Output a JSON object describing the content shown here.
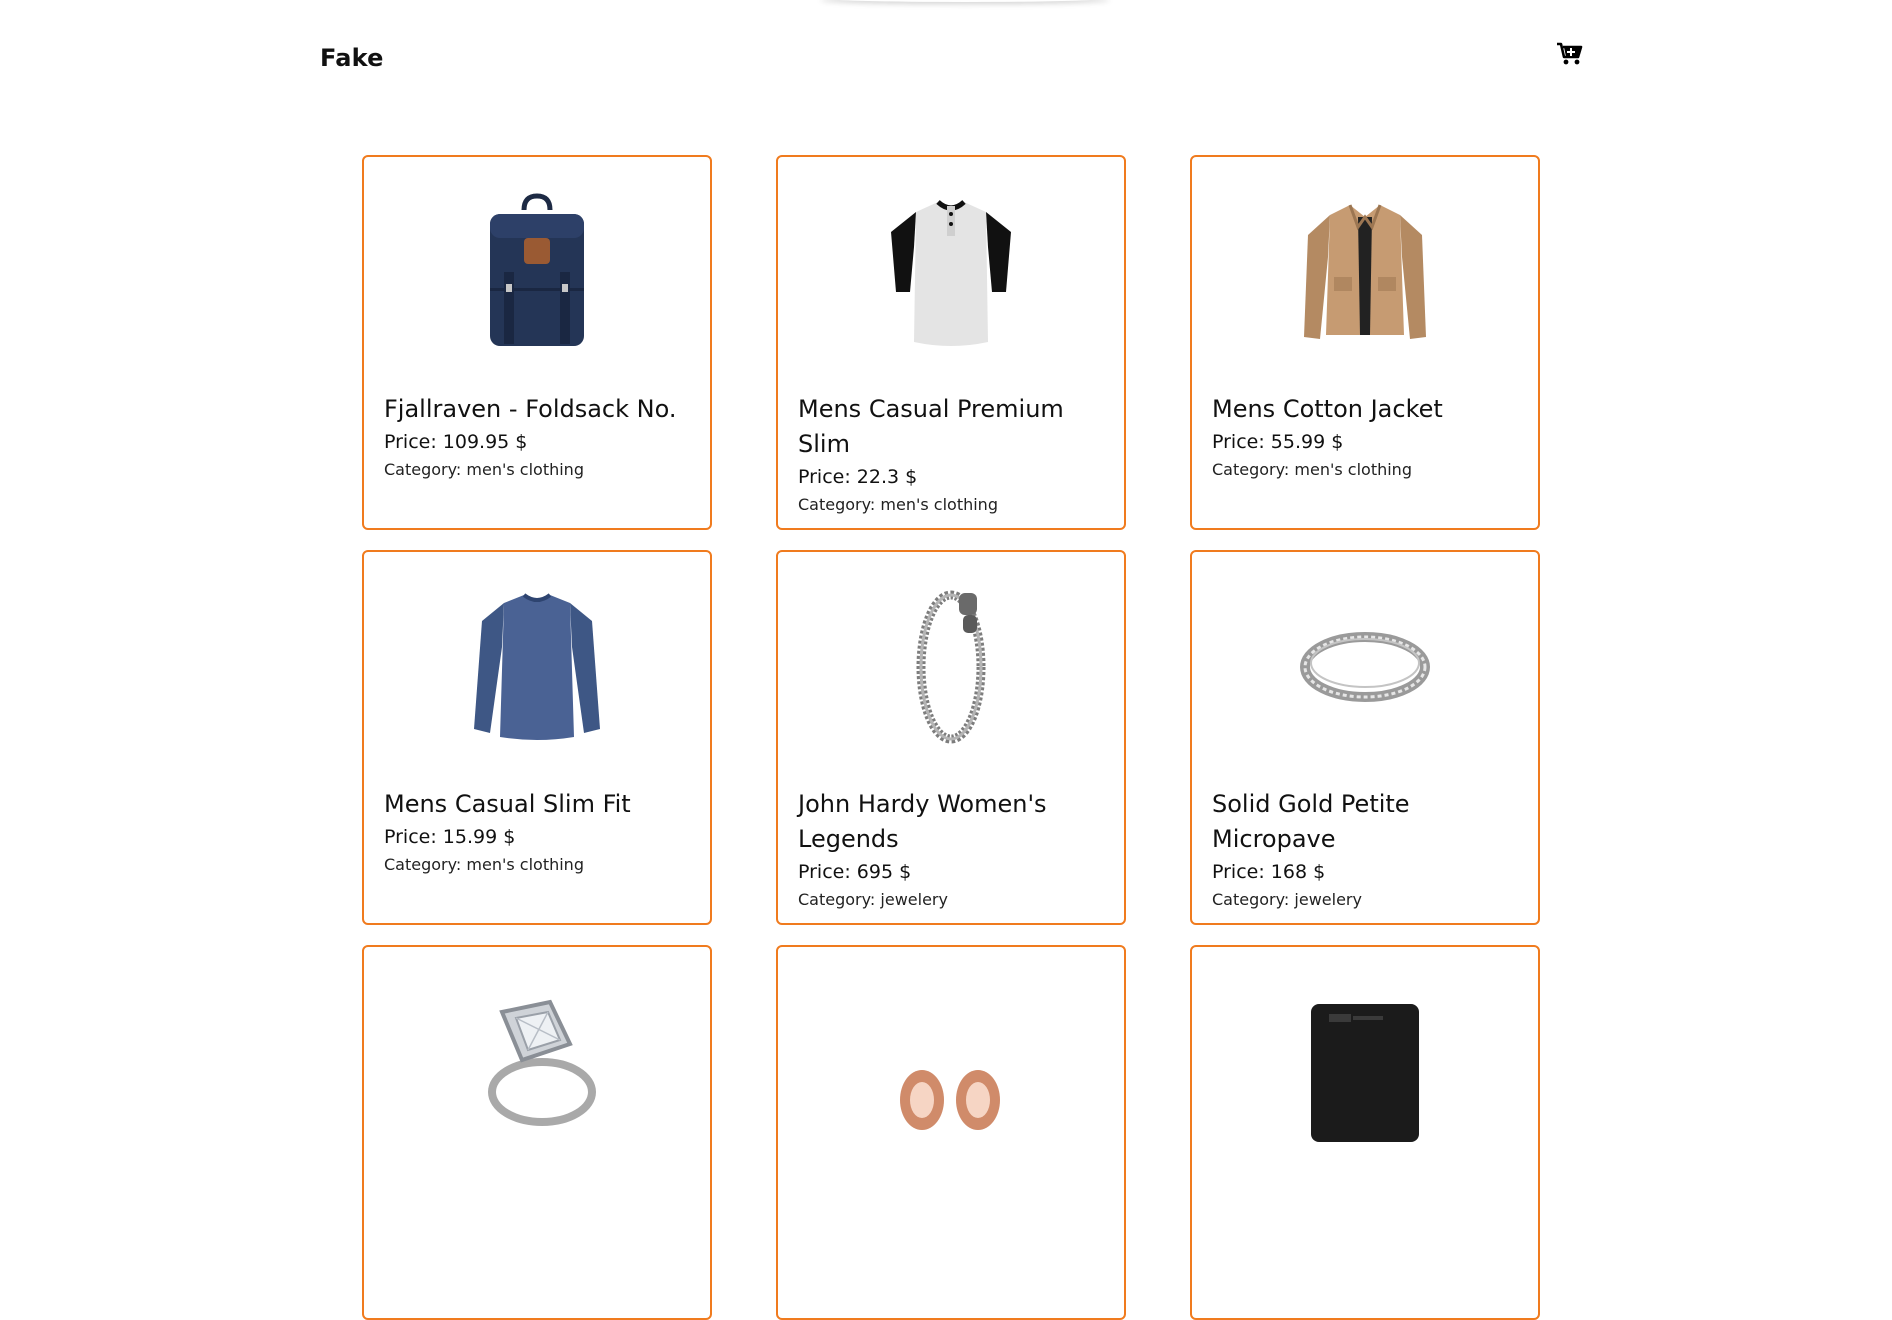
{
  "header": {
    "logo": "Fake",
    "cart_icon": "cart-icon"
  },
  "colors": {
    "accent": "#f07b1e"
  },
  "products": [
    {
      "title": "Fjallraven - Foldsack No.",
      "price": "Price: 109.95 $",
      "category": "Category: men's clothing",
      "icon": "backpack-image"
    },
    {
      "title": "Mens Casual Premium Slim",
      "price": "Price: 22.3 $",
      "category": "Category: men's clothing",
      "icon": "tshirt-image"
    },
    {
      "title": "Mens Cotton Jacket",
      "price": "Price: 55.99 $",
      "category": "Category: men's clothing",
      "icon": "jacket-image"
    },
    {
      "title": "Mens Casual Slim Fit",
      "price": "Price: 15.99 $",
      "category": "Category: men's clothing",
      "icon": "longsleeve-image"
    },
    {
      "title": "John Hardy Women's Legends",
      "price": "Price: 695 $",
      "category": "Category: jewelery",
      "icon": "bracelet-image"
    },
    {
      "title": "Solid Gold Petite Micropave",
      "price": "Price: 168 $",
      "category": "Category: jewelery",
      "icon": "ring-image"
    },
    {
      "title": "",
      "price": "",
      "category": "",
      "icon": "diamond-ring-image"
    },
    {
      "title": "",
      "price": "",
      "category": "",
      "icon": "earrings-image"
    },
    {
      "title": "",
      "price": "",
      "category": "",
      "icon": "hard-drive-image"
    }
  ]
}
